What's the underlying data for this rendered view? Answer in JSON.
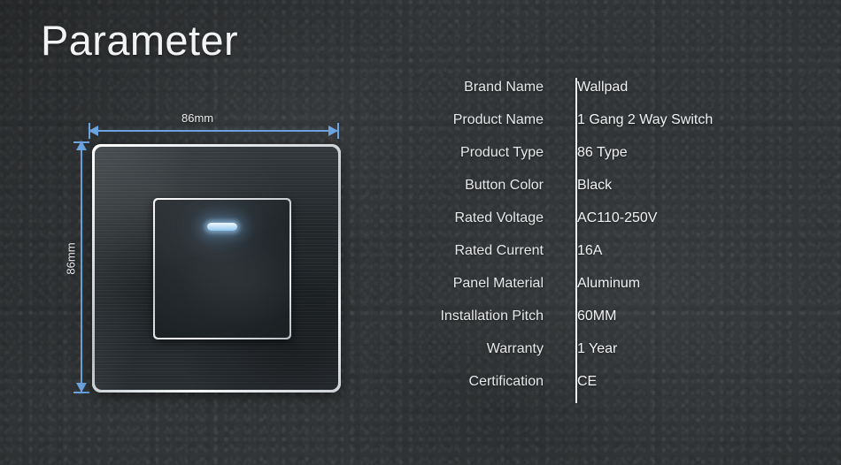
{
  "page": {
    "title": "Parameter",
    "background_color": "#323537"
  },
  "product_image": {
    "alt_name": "wall-switch-panel",
    "panel_color": "#23282b",
    "bezel_color": "#e3e6e9",
    "led_color": "#b9dcf5",
    "dimensions": {
      "accent_color": "#6ba4e0",
      "width_label": "86mm",
      "height_label": "86mm"
    }
  },
  "specs": {
    "rows": [
      {
        "label": "Brand Name",
        "value": "Wallpad"
      },
      {
        "label": "Product Name",
        "value": "1 Gang 2 Way Switch"
      },
      {
        "label": "Product Type",
        "value": "86 Type"
      },
      {
        "label": "Button Color",
        "value": "Black"
      },
      {
        "label": "Rated Voltage",
        "value": "AC110-250V"
      },
      {
        "label": "Rated Current",
        "value": "16A"
      },
      {
        "label": "Panel Material",
        "value": "Aluminum"
      },
      {
        "label": "Installation Pitch",
        "value": "60MM"
      },
      {
        "label": "Warranty",
        "value": "1 Year"
      },
      {
        "label": "Certification",
        "value": "CE"
      }
    ]
  }
}
